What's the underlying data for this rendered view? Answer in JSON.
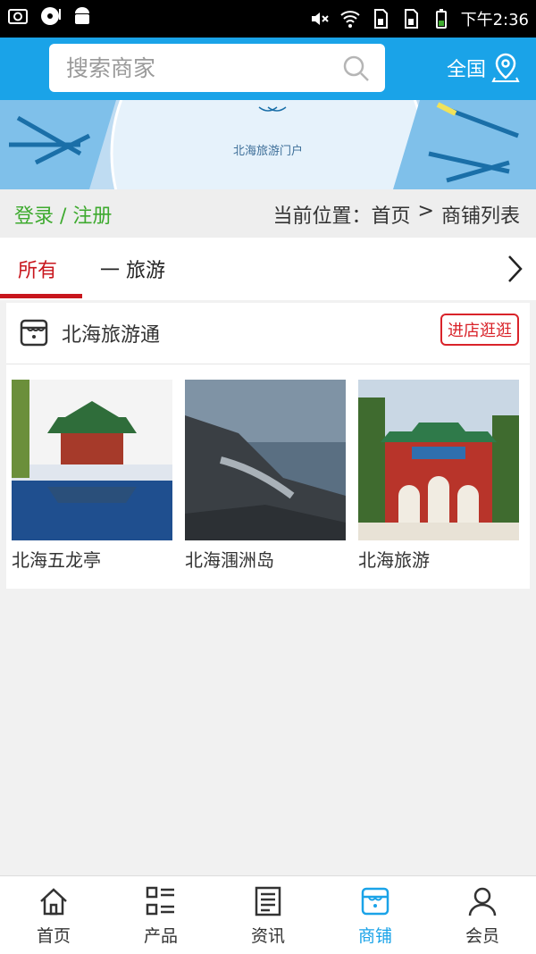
{
  "status_bar": {
    "time": "下午2:36"
  },
  "header": {
    "search": {
      "placeholder": "搜索商家"
    },
    "region": "全国"
  },
  "banner": {
    "text": "北海旅游门户"
  },
  "breadcrumb_bar": {
    "login_link": "登录 / 注册",
    "position_label": "当前位置：",
    "home": "首页",
    "separator": ">",
    "current": "商铺列表"
  },
  "tabs": [
    {
      "label": "所有",
      "active": true
    },
    {
      "label": "一 旅游",
      "active": false
    }
  ],
  "shop": {
    "name": "北海旅游通",
    "enter_button": "进店逛逛",
    "items": [
      {
        "caption": "北海五龙亭"
      },
      {
        "caption": "北海涠洲岛"
      },
      {
        "caption": "北海旅游"
      }
    ]
  },
  "bottom_nav": [
    {
      "label": "首页",
      "icon": "home-icon",
      "active": false
    },
    {
      "label": "产品",
      "icon": "grid-list-icon",
      "active": false
    },
    {
      "label": "资讯",
      "icon": "news-icon",
      "active": false
    },
    {
      "label": "商铺",
      "icon": "store-icon",
      "active": true
    },
    {
      "label": "会员",
      "icon": "user-icon",
      "active": false
    }
  ],
  "colors": {
    "accent": "#1aa3e8",
    "active_tab": "#c8161d",
    "login_link": "#3eaa2f",
    "enter_button": "#d9232a"
  }
}
